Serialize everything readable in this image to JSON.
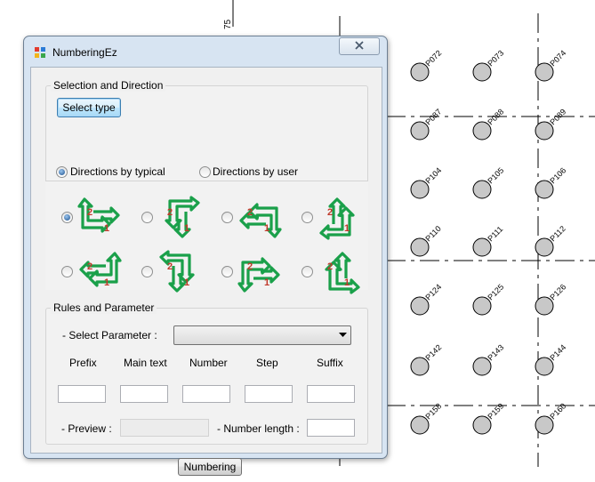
{
  "background": {
    "axis_label": "75",
    "points_row1": [
      "P072",
      "P073",
      "P074"
    ],
    "points_row2": [
      "P087",
      "P088",
      "P089"
    ],
    "points_row3": [
      "P104",
      "P105",
      "P106"
    ],
    "points_row4": [
      "P110",
      "P111",
      "P112"
    ],
    "points_row5": [
      "P124",
      "P125",
      "P126"
    ],
    "points_row6": [
      "P142",
      "P143",
      "P144"
    ],
    "points_row7": [
      "P158",
      "P159",
      "P160"
    ]
  },
  "window": {
    "title": "NumberingEz",
    "selection_group": "Selection and Direction",
    "select_type_button": "Select type",
    "direction_typical": "Directions by typical",
    "direction_user": "Directions by user",
    "rules_group": "Rules and Parameter",
    "select_parameter_label": "- Select Parameter :",
    "select_parameter_value": "",
    "columns": {
      "prefix": "Prefix",
      "main_text": "Main text",
      "number": "Number",
      "step": "Step",
      "suffix": "Suffix"
    },
    "values": {
      "prefix": "",
      "main_text": "",
      "number": "",
      "step": "",
      "suffix": ""
    },
    "preview_label": "- Preview :",
    "preview_value": "",
    "number_length_label": "- Number length :",
    "number_length_value": "",
    "numbering_button": "Numbering",
    "direction_selected": 0
  },
  "colors": {
    "arrow_green": "#1aa04a",
    "arrow_number_red": "#c0392b"
  }
}
